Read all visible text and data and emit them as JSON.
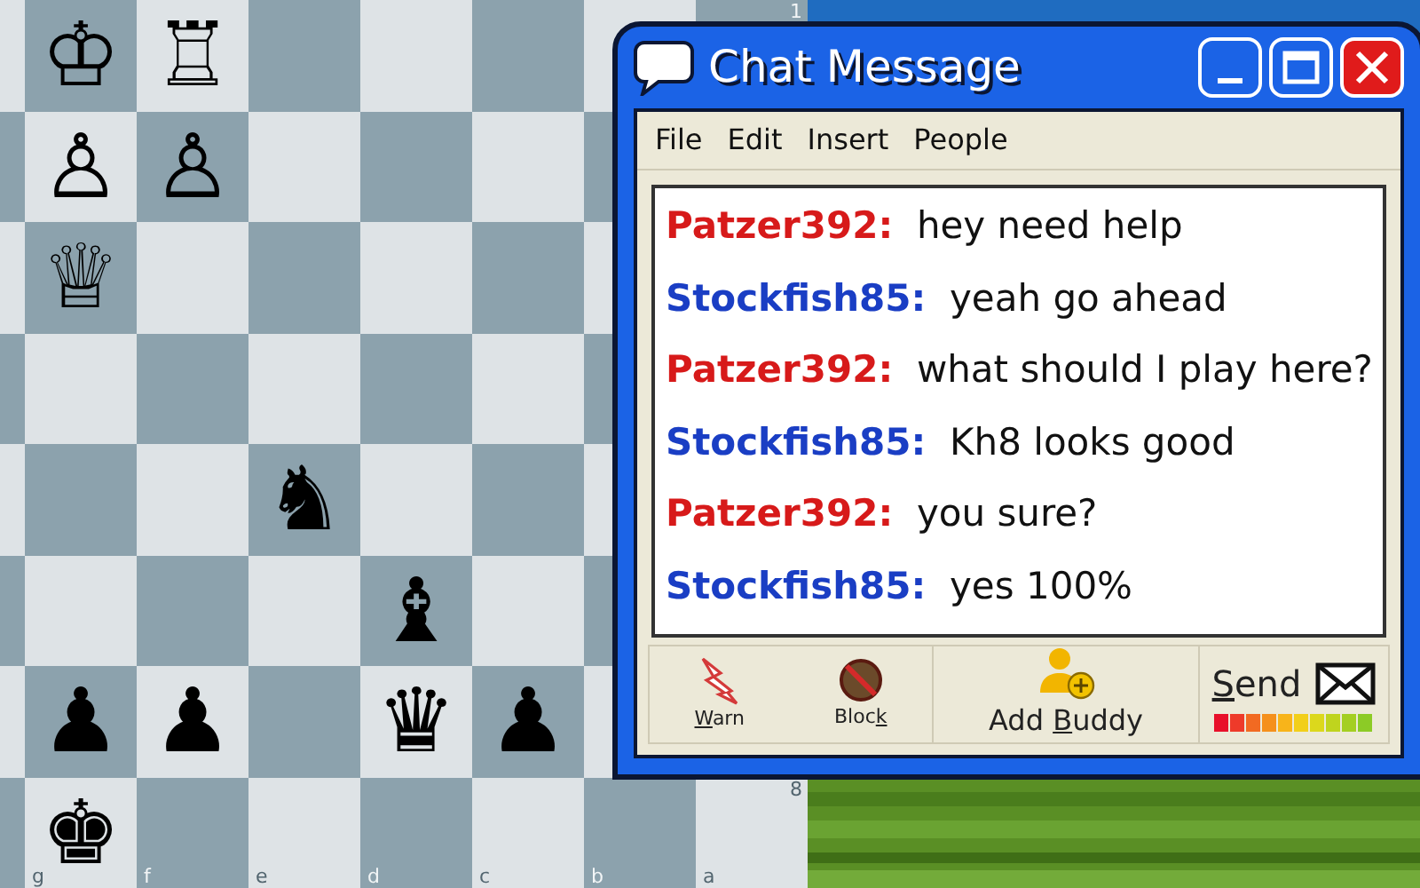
{
  "board": {
    "rows": [
      [
        {},
        {
          "piece": "♔"
        },
        {
          "piece": "♖"
        },
        {},
        {},
        {},
        {},
        {
          "rank_label": "1"
        }
      ],
      [
        {},
        {
          "piece": "♙"
        },
        {
          "piece": "♙"
        },
        {},
        {},
        {},
        {},
        {}
      ],
      [
        {},
        {
          "piece": "♕"
        },
        {},
        {},
        {},
        {},
        {},
        {}
      ],
      [
        {},
        {},
        {},
        {},
        {},
        {},
        {},
        {}
      ],
      [
        {},
        {},
        {},
        {
          "piece": "♞"
        },
        {},
        {},
        {},
        {}
      ],
      [
        {},
        {},
        {},
        {},
        {
          "piece": "♝"
        },
        {},
        {},
        {}
      ],
      [
        {},
        {
          "piece": "♟"
        },
        {
          "piece": "♟"
        },
        {},
        {
          "piece": "♛"
        },
        {
          "piece": "♟"
        },
        {},
        {}
      ],
      [
        {},
        {
          "piece": "♚",
          "file_label": "g"
        },
        {
          "file_label": "f"
        },
        {
          "file_label": "e"
        },
        {
          "file_label": "d"
        },
        {
          "file_label": "c"
        },
        {
          "file_label": "b"
        },
        {
          "file_label": "a",
          "rank_label": "8"
        }
      ]
    ]
  },
  "chat_window": {
    "title": "Chat Message",
    "menu": [
      "File",
      "Edit",
      "Insert",
      "People"
    ],
    "messages": [
      {
        "sender": "Patzer392:",
        "text": "hey need help",
        "color": "#d71a1a"
      },
      {
        "sender": "Stockfish85:",
        "text": "yeah go ahead",
        "color": "#1a3ec4"
      },
      {
        "sender": "Patzer392:",
        "text": "what should I play here?",
        "color": "#d71a1a"
      },
      {
        "sender": "Stockfish85:",
        "text": "Kh8 looks good",
        "color": "#1a3ec4"
      },
      {
        "sender": "Patzer392:",
        "text": "you sure?",
        "color": "#d71a1a"
      },
      {
        "sender": "Stockfish85:",
        "text": "yes 100%",
        "color": "#1a3ec4"
      }
    ],
    "toolbar": [
      {
        "kind": "warn",
        "key": "W",
        "after": "arn"
      },
      {
        "kind": "block",
        "before": "Bloc",
        "key": "k"
      },
      {
        "kind": "add-buddy",
        "before": "Add ",
        "key": "B",
        "after": "uddy"
      },
      {
        "kind": "send",
        "key": "S",
        "after": "end"
      }
    ],
    "send_meter": {
      "level": 1
    }
  }
}
